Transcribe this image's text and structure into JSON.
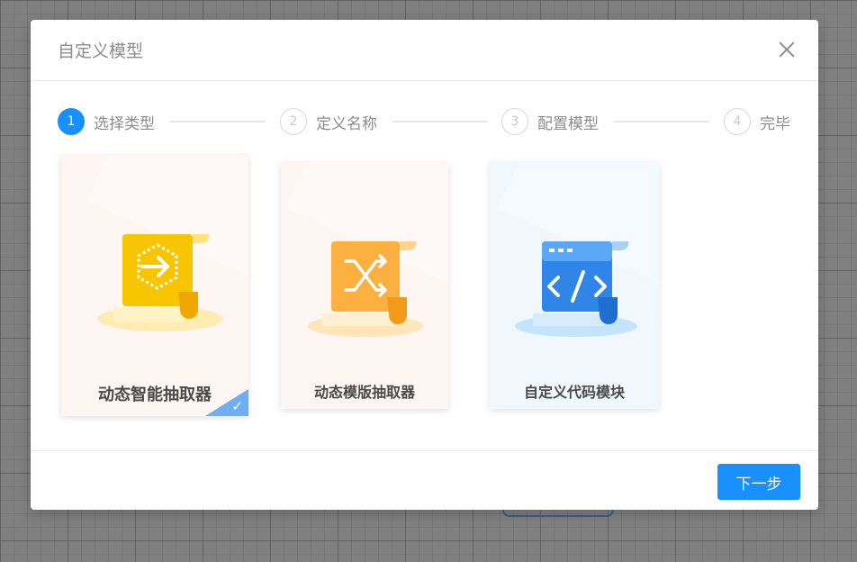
{
  "dialog": {
    "title": "自定义模型",
    "close_icon": "close-icon"
  },
  "steps": [
    {
      "number": "1",
      "label": "选择类型",
      "active": true
    },
    {
      "number": "2",
      "label": "定义名称",
      "active": false
    },
    {
      "number": "3",
      "label": "配置模型",
      "active": false
    },
    {
      "number": "4",
      "label": "完毕",
      "active": false
    }
  ],
  "cards": [
    {
      "label": "动态智能抽取器",
      "icon": "arrow-hexagon-scroll-icon",
      "selected": true,
      "accent": "#f7c600"
    },
    {
      "label": "动态模版抽取器",
      "icon": "shuffle-scroll-icon",
      "selected": false,
      "accent": "#fbb040"
    },
    {
      "label": "自定义代码模块",
      "icon": "code-scroll-icon",
      "selected": false,
      "accent": "#2f86e8"
    }
  ],
  "selected_check_icon": "checkmark-icon",
  "footer": {
    "next_label": "下一步"
  },
  "colors": {
    "primary": "#1890ff",
    "overlay": "#808080"
  }
}
